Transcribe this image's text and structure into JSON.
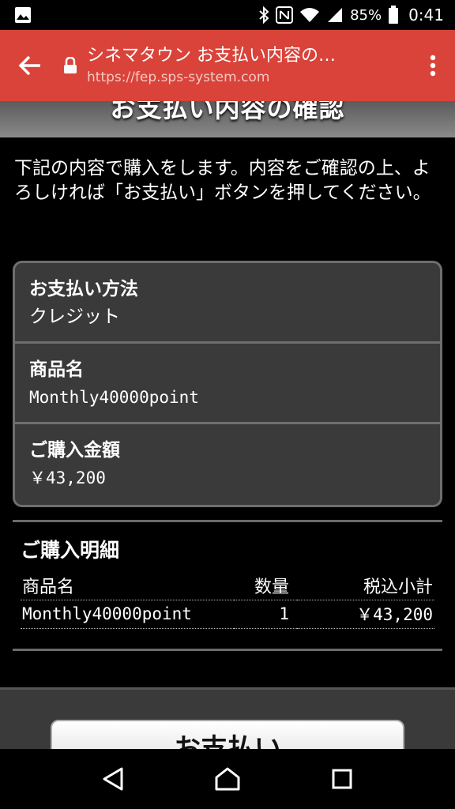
{
  "status_bar": {
    "battery": "85%",
    "time": "0:41",
    "icons": [
      "image-icon",
      "bluetooth-icon",
      "nfc-icon",
      "wifi-icon",
      "signal-icon",
      "battery-icon"
    ]
  },
  "browser": {
    "title": "シネマタウン お支払い内容の…",
    "url": "https://fep.sps-system.com"
  },
  "page": {
    "heading": "お支払い内容の確認",
    "intro": "下記の内容で購入をします。内容をご確認の上、よろしければ「お支払い」ボタンを押してください。"
  },
  "summary": [
    {
      "label": "お支払い方法",
      "value": "クレジット"
    },
    {
      "label": "商品名",
      "value": "Monthly40000point"
    },
    {
      "label": "ご購入金額",
      "value": "￥43,200"
    }
  ],
  "detail": {
    "title": "ご購入明細",
    "headers": {
      "name": "商品名",
      "qty": "数量",
      "subtotal": "税込小計"
    },
    "rows": [
      {
        "name": "Monthly40000point",
        "qty": "1",
        "subtotal": "￥43,200"
      }
    ]
  },
  "pay_button": {
    "label": "お支払い"
  },
  "colors": {
    "toolbar": "#d9433a",
    "background": "#000000",
    "panel": "#3a3a3a"
  }
}
